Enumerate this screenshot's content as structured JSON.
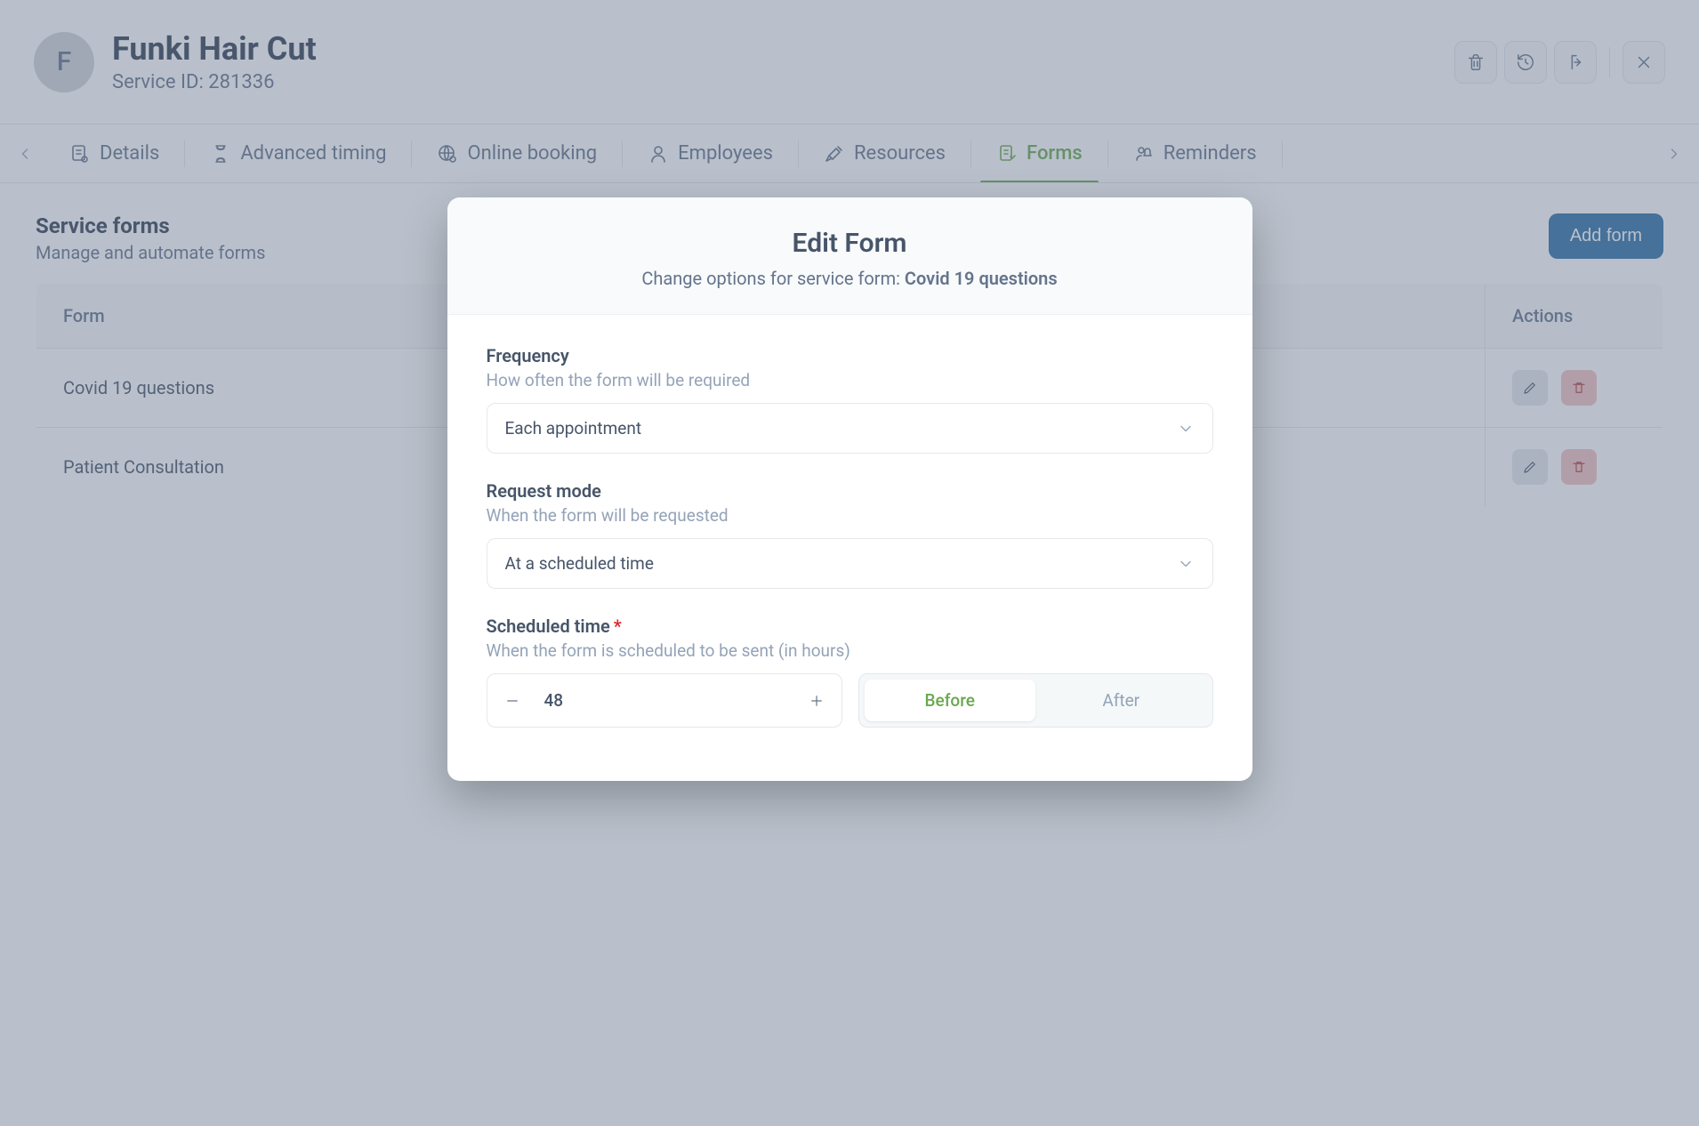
{
  "header": {
    "avatar_letter": "F",
    "title": "Funki Hair Cut",
    "service_id_label": "Service ID:",
    "service_id": "281336"
  },
  "tabs": [
    {
      "id": "details",
      "label": "Details",
      "icon": "details-icon"
    },
    {
      "id": "advanced-timing",
      "label": "Advanced timing",
      "icon": "hourglass-icon"
    },
    {
      "id": "online-booking",
      "label": "Online booking",
      "icon": "globe-gear-icon"
    },
    {
      "id": "employees",
      "label": "Employees",
      "icon": "person-icon"
    },
    {
      "id": "resources",
      "label": "Resources",
      "icon": "tools-icon"
    },
    {
      "id": "forms",
      "label": "Forms",
      "icon": "forms-icon",
      "active": true
    },
    {
      "id": "reminders",
      "label": "Reminders",
      "icon": "bell-person-icon"
    }
  ],
  "section": {
    "heading": "Service forms",
    "sub": "Manage and automate forms",
    "add_button_label": "Add form"
  },
  "table": {
    "col_form": "Form",
    "col_actions": "Actions",
    "rows": [
      {
        "name": "Covid 19 questions"
      },
      {
        "name": "Patient Consultation"
      }
    ]
  },
  "modal": {
    "title": "Edit Form",
    "sub_prefix": "Change options for service form: ",
    "form_name": "Covid 19 questions",
    "frequency_label": "Frequency",
    "frequency_desc": "How often the form will be required",
    "frequency_value": "Each appointment",
    "request_mode_label": "Request mode",
    "request_mode_desc": "When the form will be requested",
    "request_mode_value": "At a scheduled time",
    "scheduled_label": "Scheduled time",
    "scheduled_desc": "When the form is scheduled to be sent (in hours)",
    "scheduled_value": "48",
    "toggle_before": "Before",
    "toggle_after": "After",
    "toggle_active": "before"
  }
}
